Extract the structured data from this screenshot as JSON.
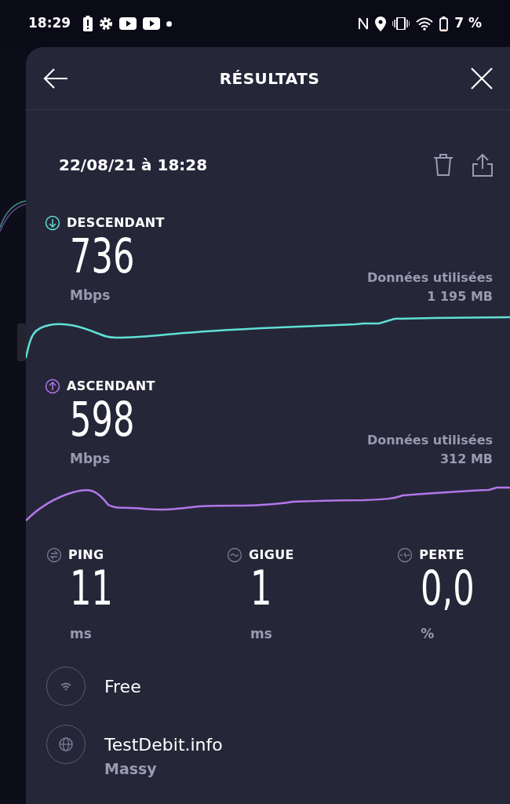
{
  "status_bar": {
    "time": "18:29",
    "battery": "7 %"
  },
  "header": {
    "title": "RÉSULTATS"
  },
  "result": {
    "date": "22/08/21 à 18:28"
  },
  "speeds": [
    {
      "kind": "download",
      "label": "DESCENDANT",
      "value": "736",
      "unit": "Mbps",
      "data_label": "Données utilisées",
      "data_value": "1 195 MB",
      "color": "#5fe0d6"
    },
    {
      "kind": "upload",
      "label": "ASCENDANT",
      "value": "598",
      "unit": "Mbps",
      "data_label": "Données utilisées",
      "data_value": "312 MB",
      "color": "#b277e8"
    }
  ],
  "metrics": [
    {
      "kind": "ping",
      "label": "PING",
      "value": "11",
      "unit": "ms"
    },
    {
      "kind": "jitter",
      "label": "GIGUE",
      "value": "1",
      "unit": "ms"
    },
    {
      "kind": "loss",
      "label": "PERTE",
      "value": "0,0",
      "unit": "%"
    }
  ],
  "connections": [
    {
      "kind": "wifi",
      "name": "Free"
    },
    {
      "kind": "server",
      "name": "TestDebit.info",
      "location": "Massy"
    }
  ]
}
